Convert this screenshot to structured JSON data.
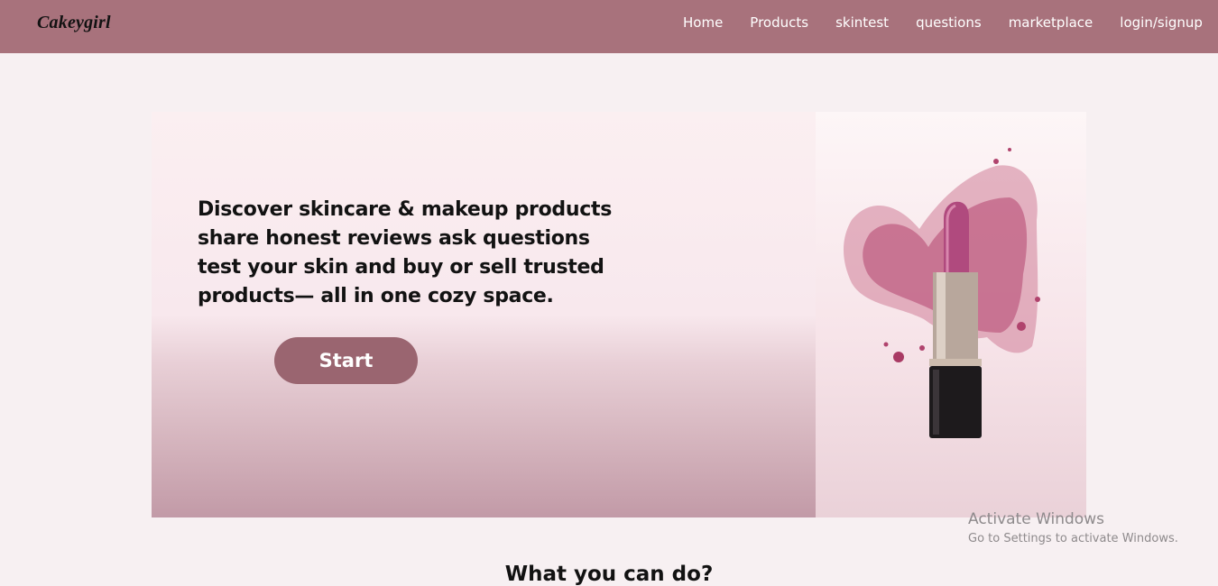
{
  "nav": {
    "logo": "Cakeygirl",
    "links": [
      {
        "label": "Home"
      },
      {
        "label": "Products"
      },
      {
        "label": "skintest"
      },
      {
        "label": "questions"
      },
      {
        "label": "marketplace"
      },
      {
        "label": "login/signup"
      }
    ]
  },
  "hero": {
    "text": "Discover skincare & makeup products share honest reviews ask questions test your skin and buy or sell trusted products— all in one cozy space.",
    "button_label": "Start",
    "image_icon": "lipstick-splash-icon"
  },
  "section": {
    "title": "What you can do?"
  },
  "activation": {
    "title": "Activate Windows",
    "subtitle": "Go to Settings to activate Windows."
  },
  "colors": {
    "nav_background": "#a8727c",
    "button_background": "#9a6570",
    "page_background": "#f7f0f2",
    "lipstick": "#b04a7e"
  }
}
